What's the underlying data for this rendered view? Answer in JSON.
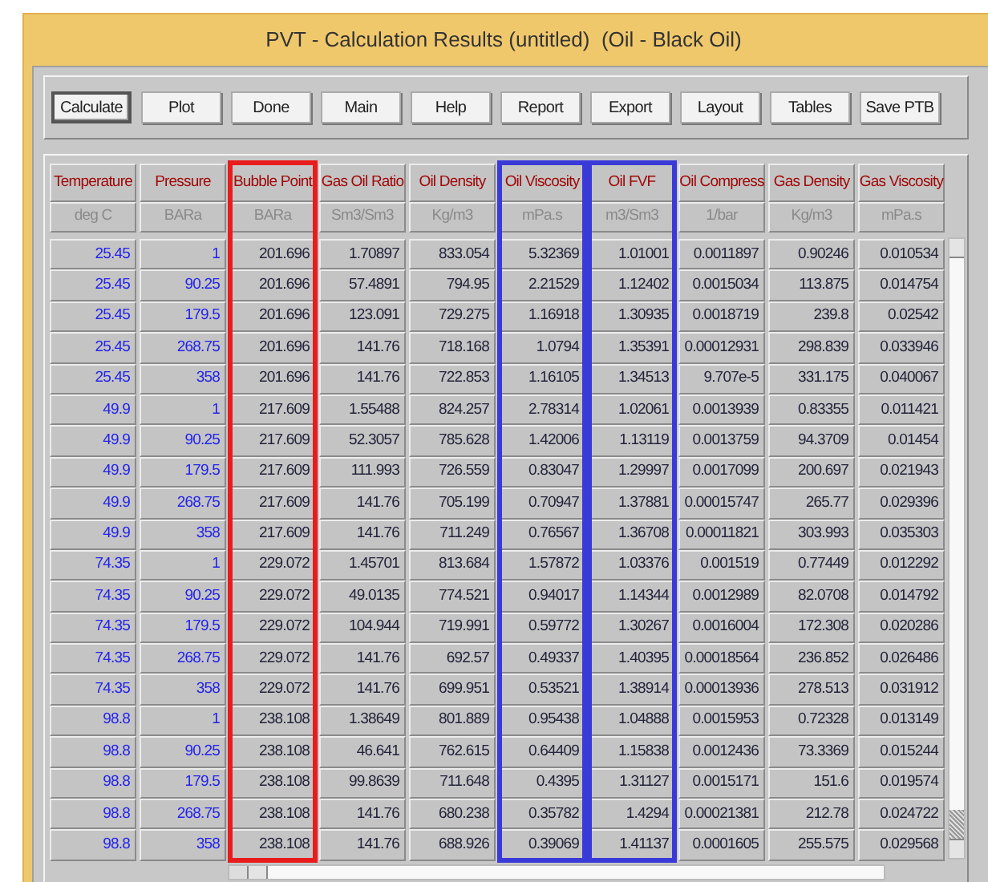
{
  "window": {
    "title": "PVT - Calculation Results (untitled)  (Oil - Black Oil)"
  },
  "toolbar": {
    "buttons": [
      {
        "label": "Calculate",
        "default": true
      },
      {
        "label": "Plot",
        "default": false
      },
      {
        "label": "Done",
        "default": false
      },
      {
        "label": "Main",
        "default": false
      },
      {
        "label": "Help",
        "default": false
      },
      {
        "label": "Report",
        "default": false
      },
      {
        "label": "Export",
        "default": false
      },
      {
        "label": "Layout",
        "default": false
      },
      {
        "label": "Tables",
        "default": false
      },
      {
        "label": "Save PTB",
        "default": false
      }
    ]
  },
  "table": {
    "columns": [
      {
        "name": "Temperature",
        "unit": "deg C",
        "kind": "input"
      },
      {
        "name": "Pressure",
        "unit": "BARa",
        "kind": "input"
      },
      {
        "name": "Bubble Point",
        "unit": "BARa",
        "kind": "output",
        "color": "#e81c1c"
      },
      {
        "name": "Gas Oil Ratio",
        "unit": "Sm3/Sm3",
        "kind": "output"
      },
      {
        "name": "Oil Density",
        "unit": "Kg/m3",
        "kind": "output"
      },
      {
        "name": "Oil Viscosity",
        "unit": "mPa.s",
        "kind": "output",
        "color": "#3a3ad8"
      },
      {
        "name": "Oil FVF",
        "unit": "m3/Sm3",
        "kind": "output",
        "color": "#3a3ad8"
      },
      {
        "name": "Oil Compress",
        "unit": "1/bar",
        "kind": "output"
      },
      {
        "name": "Gas Density",
        "unit": "Kg/m3",
        "kind": "output"
      },
      {
        "name": "Gas Viscosity",
        "unit": "mPa.s",
        "kind": "output"
      }
    ],
    "rows": [
      [
        "25.45",
        "1",
        "201.696",
        "1.70897",
        "833.054",
        "5.32369",
        "1.01001",
        "0.0011897",
        "0.90246",
        "0.010534"
      ],
      [
        "25.45",
        "90.25",
        "201.696",
        "57.4891",
        "794.95",
        "2.21529",
        "1.12402",
        "0.0015034",
        "113.875",
        "0.014754"
      ],
      [
        "25.45",
        "179.5",
        "201.696",
        "123.091",
        "729.275",
        "1.16918",
        "1.30935",
        "0.0018719",
        "239.8",
        "0.02542"
      ],
      [
        "25.45",
        "268.75",
        "201.696",
        "141.76",
        "718.168",
        "1.0794",
        "1.35391",
        "0.00012931",
        "298.839",
        "0.033946"
      ],
      [
        "25.45",
        "358",
        "201.696",
        "141.76",
        "722.853",
        "1.16105",
        "1.34513",
        "9.707e-5",
        "331.175",
        "0.040067"
      ],
      [
        "49.9",
        "1",
        "217.609",
        "1.55488",
        "824.257",
        "2.78314",
        "1.02061",
        "0.0013939",
        "0.83355",
        "0.011421"
      ],
      [
        "49.9",
        "90.25",
        "217.609",
        "52.3057",
        "785.628",
        "1.42006",
        "1.13119",
        "0.0013759",
        "94.3709",
        "0.01454"
      ],
      [
        "49.9",
        "179.5",
        "217.609",
        "111.993",
        "726.559",
        "0.83047",
        "1.29997",
        "0.0017099",
        "200.697",
        "0.021943"
      ],
      [
        "49.9",
        "268.75",
        "217.609",
        "141.76",
        "705.199",
        "0.70947",
        "1.37881",
        "0.00015747",
        "265.77",
        "0.029396"
      ],
      [
        "49.9",
        "358",
        "217.609",
        "141.76",
        "711.249",
        "0.76567",
        "1.36708",
        "0.00011821",
        "303.993",
        "0.035303"
      ],
      [
        "74.35",
        "1",
        "229.072",
        "1.45701",
        "813.684",
        "1.57872",
        "1.03376",
        "0.001519",
        "0.77449",
        "0.012292"
      ],
      [
        "74.35",
        "90.25",
        "229.072",
        "49.0135",
        "774.521",
        "0.94017",
        "1.14344",
        "0.0012989",
        "82.0708",
        "0.014792"
      ],
      [
        "74.35",
        "179.5",
        "229.072",
        "104.944",
        "719.991",
        "0.59772",
        "1.30267",
        "0.0016004",
        "172.308",
        "0.020286"
      ],
      [
        "74.35",
        "268.75",
        "229.072",
        "141.76",
        "692.57",
        "0.49337",
        "1.40395",
        "0.00018564",
        "236.852",
        "0.026486"
      ],
      [
        "74.35",
        "358",
        "229.072",
        "141.76",
        "699.951",
        "0.53521",
        "1.38914",
        "0.00013936",
        "278.513",
        "0.031912"
      ],
      [
        "98.8",
        "1",
        "238.108",
        "1.38649",
        "801.889",
        "0.95438",
        "1.04888",
        "0.0015953",
        "0.72328",
        "0.013149"
      ],
      [
        "98.8",
        "90.25",
        "238.108",
        "46.641",
        "762.615",
        "0.64409",
        "1.15838",
        "0.0012436",
        "73.3369",
        "0.015244"
      ],
      [
        "98.8",
        "179.5",
        "238.108",
        "99.8639",
        "711.648",
        "0.4395",
        "1.31127",
        "0.0015171",
        "151.6",
        "0.019574"
      ],
      [
        "98.8",
        "268.75",
        "238.108",
        "141.76",
        "680.238",
        "0.35782",
        "1.4294",
        "0.00021381",
        "212.78",
        "0.024722"
      ],
      [
        "98.8",
        "358",
        "238.108",
        "141.76",
        "688.926",
        "0.39069",
        "1.41137",
        "0.0001605",
        "255.575",
        "0.029568"
      ]
    ]
  }
}
